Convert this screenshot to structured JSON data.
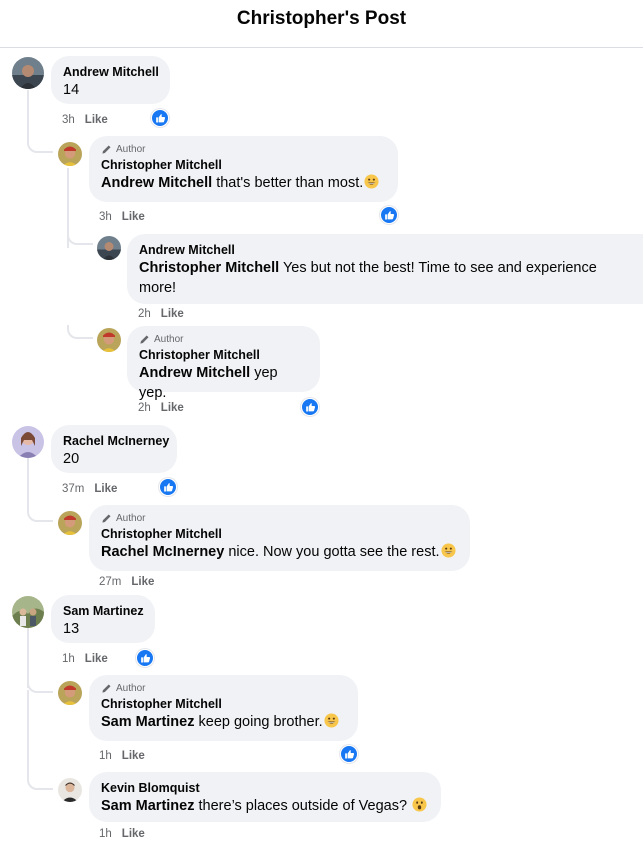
{
  "header": {
    "title": "Christopher's Post"
  },
  "author_badge": "Author",
  "like_label": "Like",
  "colors": {
    "accent": "#1877f2",
    "bubble": "#f0f2f5",
    "meta": "#65676b"
  },
  "comments": {
    "c1": {
      "name": "Andrew Mitchell",
      "text": "14",
      "time": "3h"
    },
    "c2": {
      "name": "Christopher Mitchell",
      "mention": "Andrew Mitchell",
      "text": " that's better than most.",
      "time": "3h"
    },
    "c3": {
      "name": "Andrew Mitchell",
      "mention": "Christopher Mitchell",
      "text": " Yes but not the best! Time to see and experience more!",
      "time": "2h"
    },
    "c4": {
      "name": "Christopher Mitchell",
      "mention": "Andrew Mitchell",
      "text": " yep yep.",
      "time": "2h"
    },
    "c5": {
      "name": "Rachel McInerney",
      "text": "20",
      "time": "37m"
    },
    "c6": {
      "name": "Christopher Mitchell",
      "mention": "Rachel McInerney",
      "text": " nice. Now you gotta see the rest.",
      "time": "27m"
    },
    "c7": {
      "name": "Sam Martinez",
      "text": "13",
      "time": "1h"
    },
    "c8": {
      "name": "Christopher Mitchell",
      "mention": "Sam Martinez",
      "text": " keep going brother.",
      "time": "1h"
    },
    "c9": {
      "name": "Kevin Blomquist",
      "mention": "Sam Martinez",
      "text": " there’s places outside of Vegas? ",
      "time": "1h"
    }
  }
}
